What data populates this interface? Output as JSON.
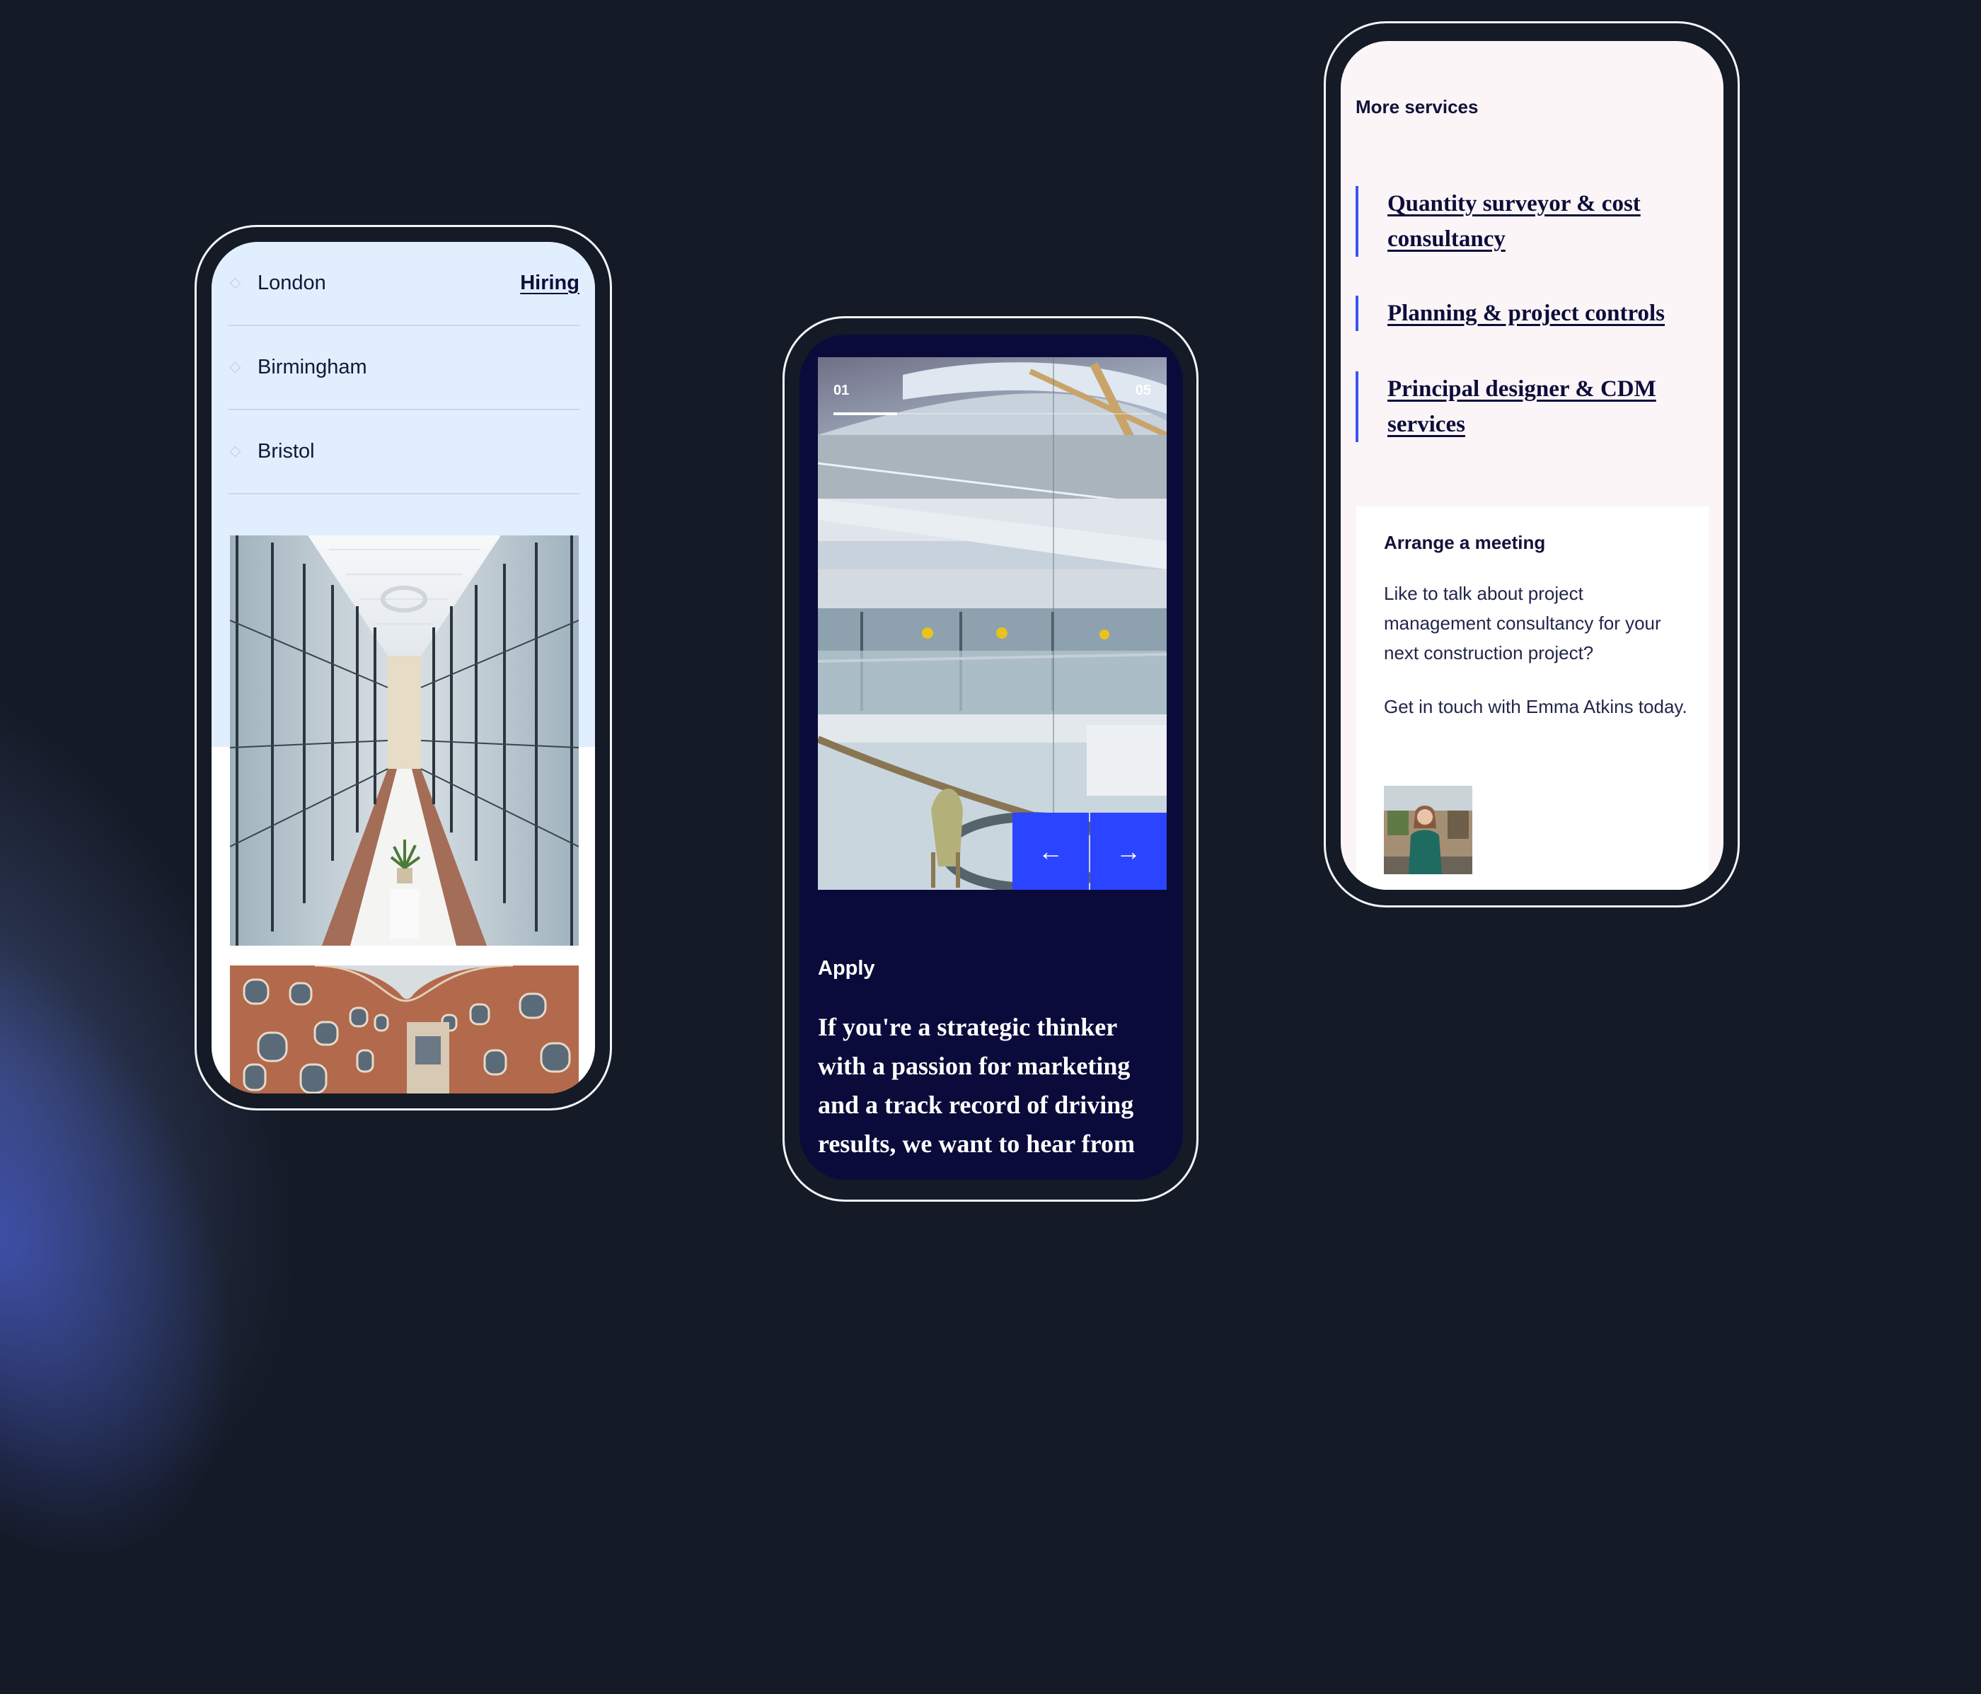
{
  "phones": {
    "locations": {
      "items": [
        {
          "name": "London",
          "badge": "Hiring"
        },
        {
          "name": "Birmingham",
          "badge": ""
        },
        {
          "name": "Bristol",
          "badge": ""
        }
      ],
      "images": [
        "atrium-photo",
        "brick-building-photo"
      ]
    },
    "careers": {
      "slider": {
        "current": "01",
        "total": "05",
        "progress_fraction": 0.2,
        "prev_icon": "arrow-left-icon",
        "next_icon": "arrow-right-icon",
        "prev_glyph": "←",
        "next_glyph": "→"
      },
      "apply_label": "Apply",
      "apply_text": "If you're a strategic thinker with a passion for marketing and a track record of driving results, we want to hear from"
    },
    "services": {
      "title": "More services",
      "links": [
        "Quantity surveyor & cost consultancy",
        "Planning & project controls",
        "Principal designer & CDM services"
      ],
      "meeting": {
        "heading": "Arrange a meeting",
        "body": "Like to talk about project management consultancy for your next construction project?",
        "contact": "Get in touch with Emma Atkins today.",
        "avatar": "emma-atkins-photo"
      }
    }
  },
  "colors": {
    "background": "#141A26",
    "locations_bg": "#E1EEFD",
    "careers_bg": "#0B0B3B",
    "services_bg": "#FBF5F7",
    "accent_blue": "#2B44FF",
    "link_bar": "#3B55F0",
    "text_dark": "#0D0D3A"
  }
}
